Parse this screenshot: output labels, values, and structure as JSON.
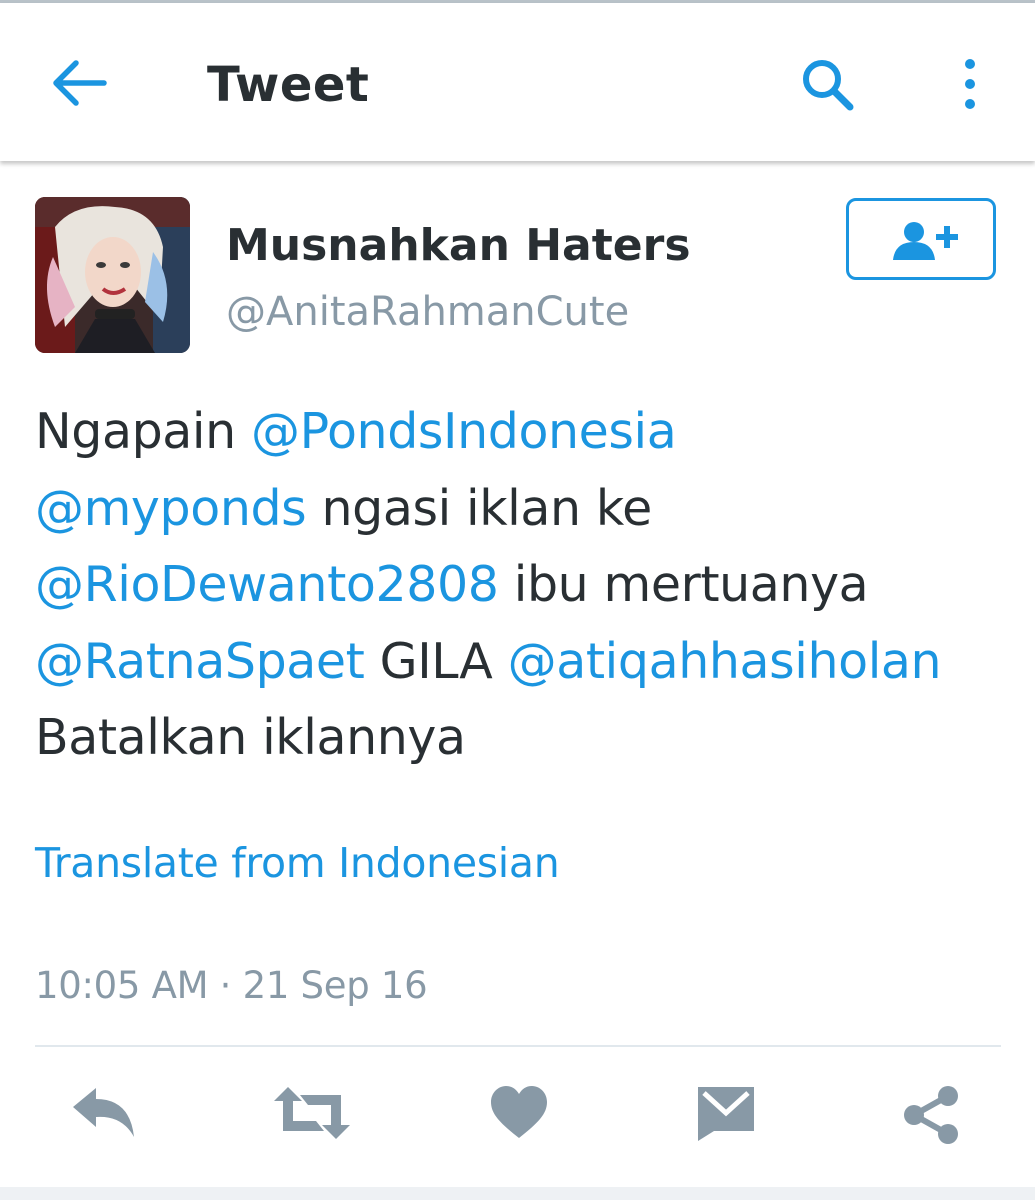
{
  "appbar": {
    "title": "Tweet",
    "icons": {
      "back": "arrow-left-icon",
      "search": "search-icon",
      "more": "more-vertical-icon"
    }
  },
  "author": {
    "display_name": "Musnahkan Haters",
    "handle": "@AnitaRahmanCute",
    "follow_icon": "add-user-icon"
  },
  "tweet": {
    "lines": [
      [
        {
          "text": "Ngapain ",
          "mention": false
        },
        {
          "text": "@PondsIndonesia",
          "mention": true
        }
      ],
      [
        {
          "text": "@myponds",
          "mention": true
        },
        {
          "text": " ngasi iklan ke",
          "mention": false
        }
      ],
      [
        {
          "text": "@RioDewanto2808",
          "mention": true
        },
        {
          "text": " ibu mertuanya",
          "mention": false
        }
      ],
      [
        {
          "text": "@RatnaSpaet",
          "mention": true
        },
        {
          "text": " GILA ",
          "mention": false
        },
        {
          "text": "@atiqahhasiholan",
          "mention": true
        }
      ],
      [
        {
          "text": "Batalkan iklannya",
          "mention": false
        }
      ]
    ],
    "translate_label": "Translate from Indonesian",
    "timestamp": "10:05 AM · 21 Sep 16"
  },
  "actions": [
    "reply-icon",
    "retweet-icon",
    "like-icon",
    "direct-message-icon",
    "share-icon"
  ],
  "colors": {
    "accent": "#1b95e0",
    "text": "#292f33",
    "secondary": "#8899a6",
    "action_icon": "#8899a6",
    "divider": "#e1e8ed"
  }
}
